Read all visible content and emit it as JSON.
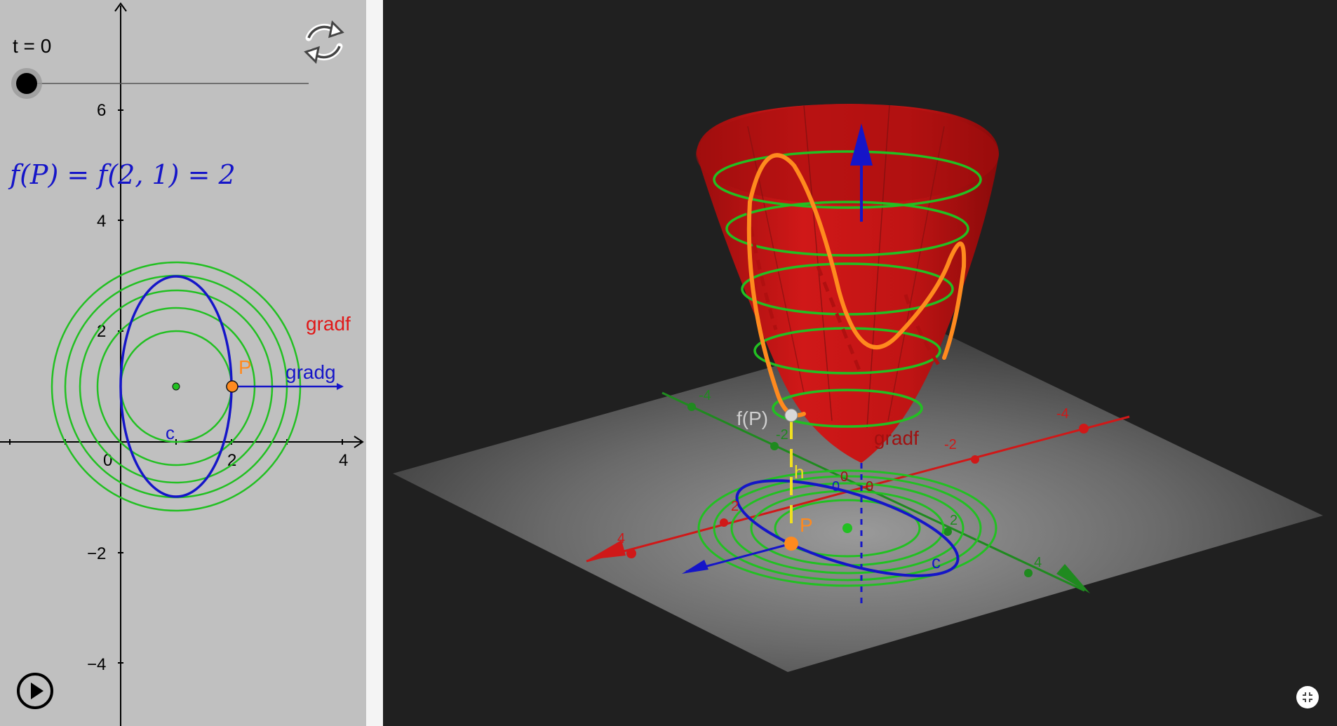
{
  "colors": {
    "panel_2d_bg": "#c0c0c0",
    "panel_3d_bg": "#202020",
    "level_curve": "#22c022",
    "curve_c": "#1515c8",
    "point_p": "#ff8a1e",
    "gradf": "#e01818",
    "gradg": "#1515c8",
    "surface": "#c81414",
    "graph_point": "#cfcfcf",
    "height_segment": "#f0e020"
  },
  "slider": {
    "label": "t = 0",
    "value": 0
  },
  "formula": {
    "text": "f(P) = f(2, 1) = 2",
    "expression": "f(P) = f(2, 1) = 2"
  },
  "view2d": {
    "x_ticks": [
      "0",
      "2",
      "4"
    ],
    "y_ticks": [
      "6",
      "4",
      "2",
      "−2",
      "−4"
    ],
    "labels": {
      "gradf": "gradf",
      "gradg": "gradg",
      "point": "P",
      "curve": "c"
    }
  },
  "view3d": {
    "x_ticks": [
      "4",
      "2",
      "-2",
      "-4"
    ],
    "y_ticks": [
      "-4",
      "-2",
      "2",
      "4"
    ],
    "origin_labels": [
      "0",
      "0",
      "0"
    ],
    "labels": {
      "fp": "f(P)",
      "h": "h",
      "point": "P",
      "gradf": "gradf",
      "curve": "c"
    }
  },
  "icons": {
    "reset": "reset-icon",
    "play": "play-icon",
    "fullscreen": "fullscreen-exit-icon"
  }
}
